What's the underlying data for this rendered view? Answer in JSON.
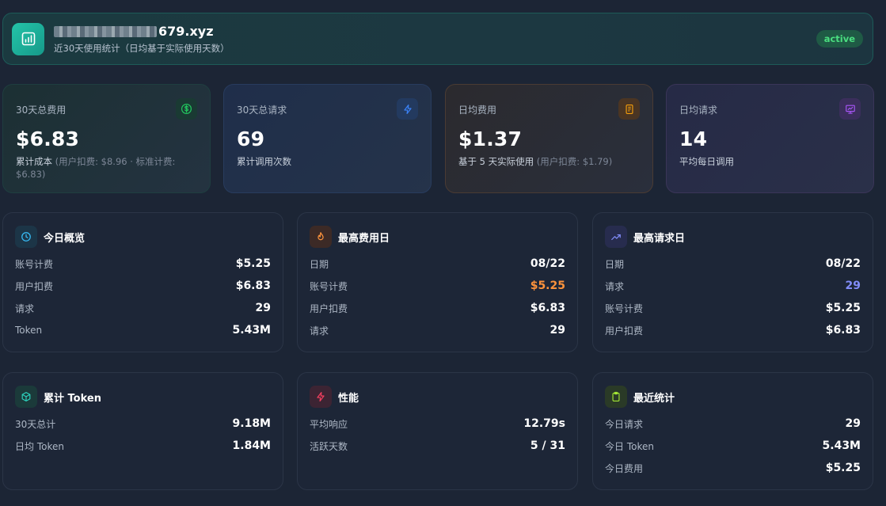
{
  "header": {
    "site_suffix": "679.xyz",
    "subtitle": "近30天使用统计（日均基于实际使用天数）",
    "status": "active",
    "logo_icon": "bar-chart-icon"
  },
  "stats": [
    {
      "label": "30天总费用",
      "value": "$6.83",
      "desc_main": "累计成本",
      "desc_muted": "(用户扣费: $8.96 · 标准计费: $6.83)",
      "icon": "dollar-icon",
      "accent": "#22c55e"
    },
    {
      "label": "30天总请求",
      "value": "69",
      "desc_main": "累计调用次数",
      "desc_muted": "",
      "icon": "bolt-icon",
      "accent": "#3b82f6"
    },
    {
      "label": "日均费用",
      "value": "$1.37",
      "desc_main": "基于 5 天实际使用",
      "desc_muted": "(用户扣费: $1.79)",
      "icon": "receipt-icon",
      "accent": "#f59e0b"
    },
    {
      "label": "日均请求",
      "value": "14",
      "desc_main": "平均每日调用",
      "desc_muted": "",
      "icon": "presentation-icon",
      "accent": "#a855f7"
    }
  ],
  "cards": {
    "today": {
      "title": "今日概览",
      "icon": "clock-icon",
      "rows": [
        {
          "label": "账号计费",
          "value": "$5.25"
        },
        {
          "label": "用户扣费",
          "value": "$6.83"
        },
        {
          "label": "请求",
          "value": "29"
        },
        {
          "label": "Token",
          "value": "5.43M"
        }
      ]
    },
    "top_cost": {
      "title": "最高费用日",
      "icon": "flame-icon",
      "rows": [
        {
          "label": "日期",
          "value": "08/22"
        },
        {
          "label": "账号计费",
          "value": "$5.25",
          "color": "#fb923c"
        },
        {
          "label": "用户扣费",
          "value": "$6.83"
        },
        {
          "label": "请求",
          "value": "29"
        }
      ]
    },
    "top_requests": {
      "title": "最高请求日",
      "icon": "trending-up-icon",
      "rows": [
        {
          "label": "日期",
          "value": "08/22"
        },
        {
          "label": "请求",
          "value": "29",
          "color": "#818cf8"
        },
        {
          "label": "账号计费",
          "value": "$5.25"
        },
        {
          "label": "用户扣费",
          "value": "$6.83"
        }
      ]
    },
    "tokens": {
      "title": "累计 Token",
      "icon": "cube-icon",
      "rows": [
        {
          "label": "30天总计",
          "value": "9.18M"
        },
        {
          "label": "日均 Token",
          "value": "1.84M"
        }
      ]
    },
    "performance": {
      "title": "性能",
      "icon": "bolt-icon",
      "rows": [
        {
          "label": "平均响应",
          "value": "12.79s"
        },
        {
          "label": "活跃天数",
          "value": "5 / 31"
        }
      ]
    },
    "recent": {
      "title": "最近统计",
      "icon": "clipboard-icon",
      "rows": [
        {
          "label": "今日请求",
          "value": "29"
        },
        {
          "label": "今日 Token",
          "value": "5.43M"
        },
        {
          "label": "今日费用",
          "value": "$5.25"
        }
      ]
    }
  }
}
